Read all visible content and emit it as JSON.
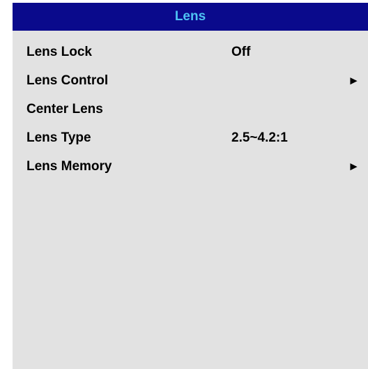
{
  "menu": {
    "title": "Lens",
    "items": [
      {
        "label": "Lens Lock",
        "value": "Off",
        "arrow": ""
      },
      {
        "label": "Lens Control",
        "value": "",
        "arrow": "►"
      },
      {
        "label": "Center Lens",
        "value": "",
        "arrow": ""
      },
      {
        "label": "Lens Type",
        "value": "2.5~4.2:1",
        "arrow": ""
      },
      {
        "label": "Lens Memory",
        "value": "",
        "arrow": "►"
      }
    ]
  },
  "colors": {
    "header_bg": "#0a0a8c",
    "header_text": "#4ec3f3",
    "panel_bg": "#e2e2e2",
    "item_text": "#000000"
  },
  "icons": {
    "submenu": "submenu-arrow-icon"
  }
}
